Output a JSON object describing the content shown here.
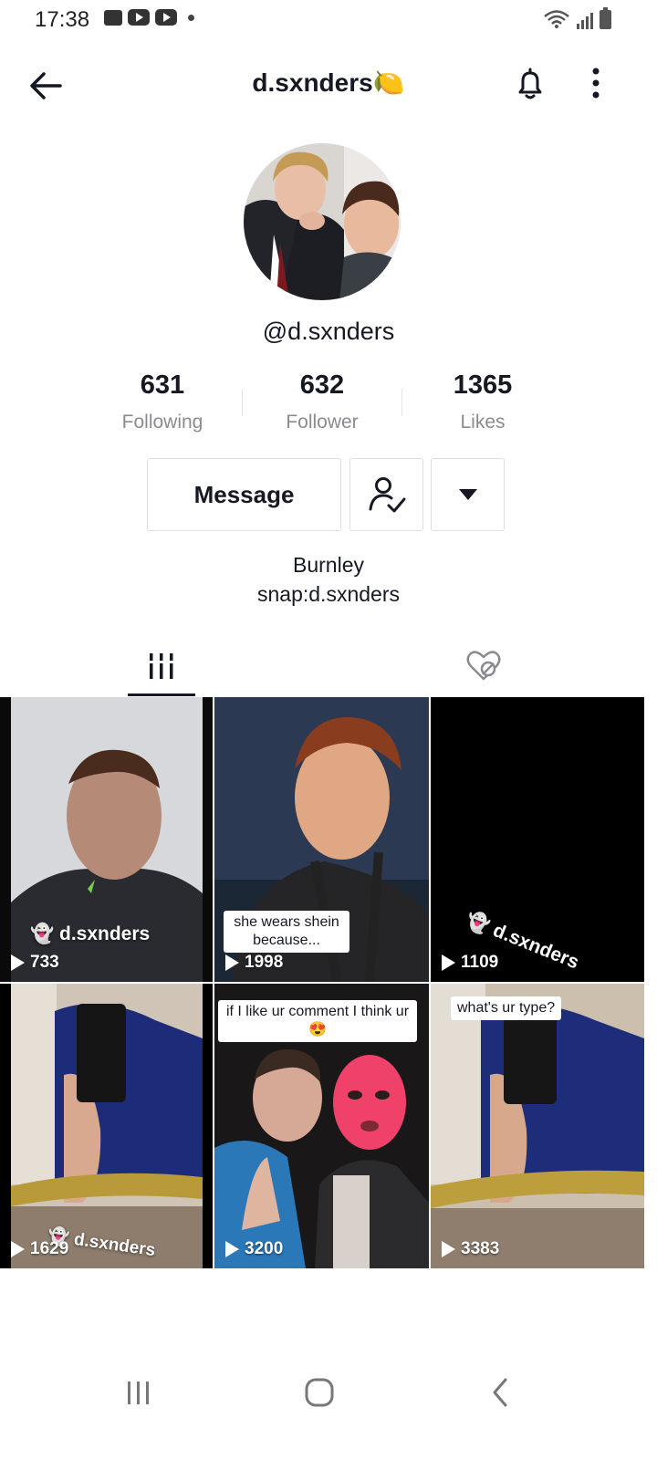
{
  "status_bar": {
    "time": "17:38"
  },
  "header": {
    "title": "d.sxnders🍋"
  },
  "profile": {
    "handle": "@d.sxnders",
    "stats": [
      {
        "value": "631",
        "label": "Following"
      },
      {
        "value": "632",
        "label": "Follower"
      },
      {
        "value": "1365",
        "label": "Likes"
      }
    ],
    "message_label": "Message",
    "bio_lines": [
      "Burnley",
      "snap:d.sxnders"
    ]
  },
  "videos": [
    {
      "views": "733",
      "watermark": "d.sxnders",
      "caption": ""
    },
    {
      "views": "1998",
      "watermark": "",
      "caption": "she wears shein because..."
    },
    {
      "views": "1109",
      "watermark": "d.sxnders",
      "caption": ""
    },
    {
      "views": "1629",
      "watermark": "d.sxnders",
      "caption": ""
    },
    {
      "views": "3200",
      "watermark": "",
      "caption": "if I like ur comment I think ur 😍"
    },
    {
      "views": "3383",
      "watermark": "",
      "caption": "what's ur type?"
    }
  ],
  "colors": {
    "text": "#161823",
    "muted": "#8a8b91",
    "border": "#dedee0"
  }
}
